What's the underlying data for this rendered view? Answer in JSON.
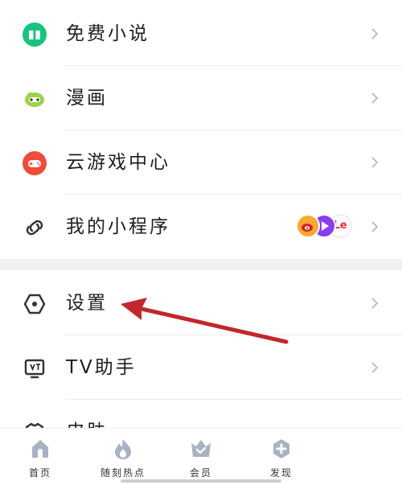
{
  "menu": {
    "items": [
      {
        "label": "免费小说",
        "icon": "book-icon"
      },
      {
        "label": "漫画",
        "icon": "comic-icon"
      },
      {
        "label": "云游戏中心",
        "icon": "gamepad-icon"
      },
      {
        "label": "我的小程序",
        "icon": "mini-program-icon",
        "badge_text": "Le"
      },
      {
        "label": "设置",
        "icon": "settings-hexagon-icon"
      },
      {
        "label": "TV助手",
        "icon": "tv-icon"
      },
      {
        "label": "皮肤",
        "icon": "skin-icon"
      }
    ]
  },
  "tabbar": {
    "tabs": [
      {
        "label": "首页",
        "icon": "home-icon"
      },
      {
        "label": "随刻热点",
        "icon": "flame-icon"
      },
      {
        "label": "会员",
        "icon": "crown-icon"
      },
      {
        "label": "发现",
        "icon": "plus-circle-icon"
      }
    ]
  },
  "colors": {
    "novel_green": "#19c37d",
    "comic_green": "#9bd44a",
    "game_red": "#ee4d3c",
    "icon_dark": "#333333",
    "tab_grey": "#a9b2c3",
    "annotation_red": "#c1272d"
  }
}
